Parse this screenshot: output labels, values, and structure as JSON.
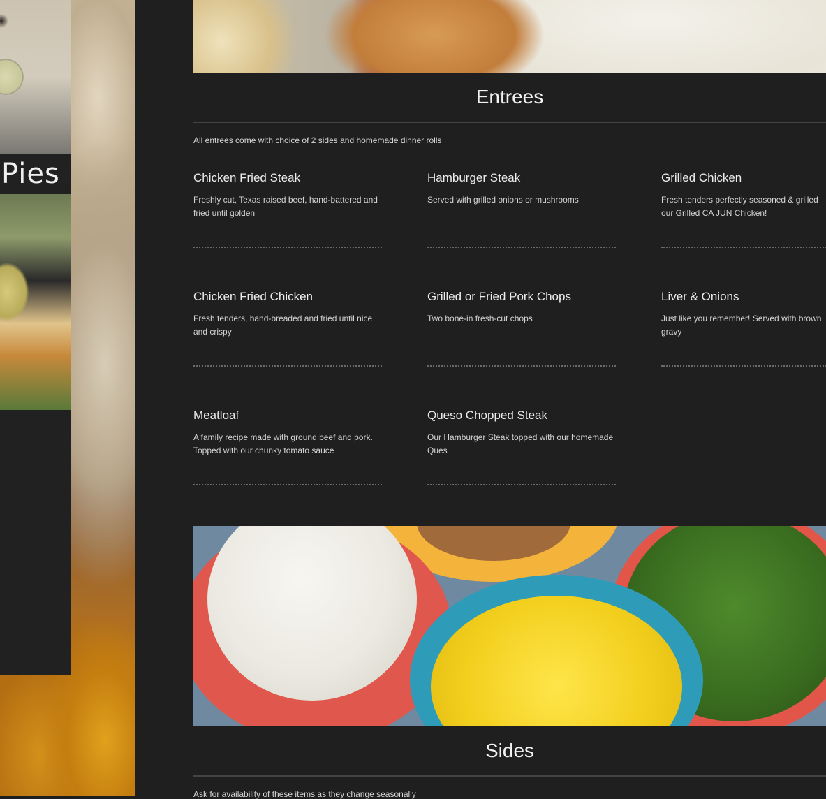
{
  "previous_section": {
    "label": "Pies"
  },
  "entrees": {
    "title": "Entrees",
    "note": "All entrees come with choice of 2 sides and homemade dinner rolls",
    "items": [
      {
        "name": "Chicken Fried Steak",
        "desc": "Freshly cut, Texas raised beef, hand-battered and fried until golden"
      },
      {
        "name": "Hamburger Steak",
        "desc": "Served with grilled onions or mushrooms"
      },
      {
        "name": "Grilled Chicken",
        "desc": "Fresh tenders perfectly seasoned & grilled our Grilled CA JUN Chicken!"
      },
      {
        "name": "Chicken Fried Chicken",
        "desc": "Fresh tenders, hand-breaded and fried until nice and crispy"
      },
      {
        "name": "Grilled or Fried Pork Chops",
        "desc": "Two bone-in fresh-cut chops"
      },
      {
        "name": "Liver & Onions",
        "desc": "Just like you remember! Served with brown gravy"
      },
      {
        "name": "Meatloaf",
        "desc": "A family recipe made with ground beef and pork. Topped with our chunky tomato sauce"
      },
      {
        "name": "Queso Chopped Steak",
        "desc": "Our Hamburger Steak topped with our homemade Ques"
      }
    ]
  },
  "sides": {
    "title": "Sides",
    "note": "Ask for availability of these items as they change seasonally"
  }
}
